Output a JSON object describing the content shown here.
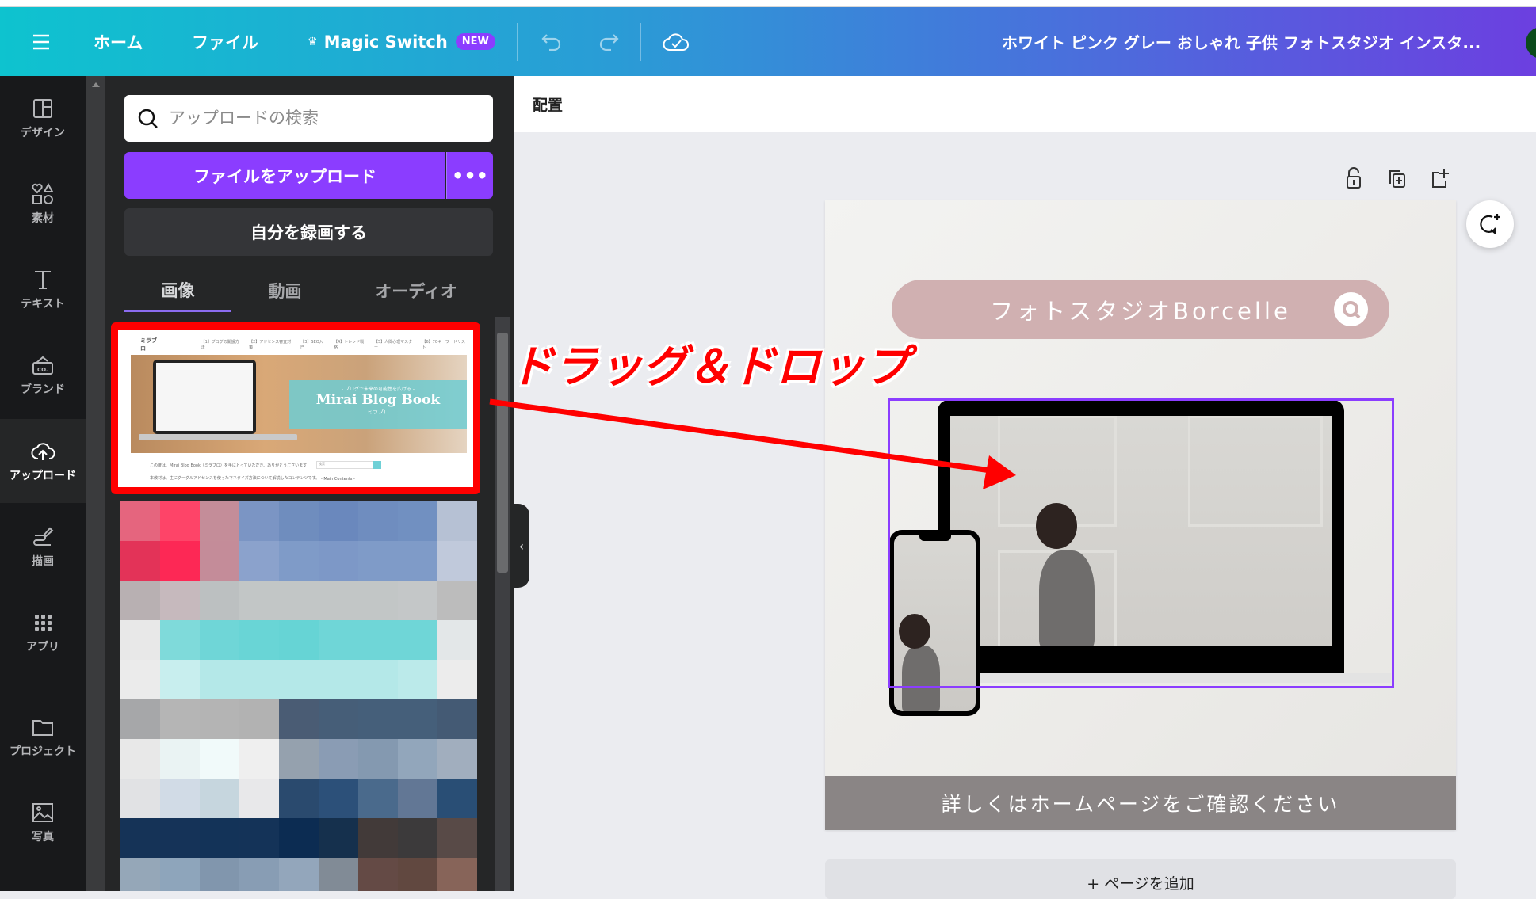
{
  "header": {
    "menu_icon": "hamburger-icon",
    "home": "ホーム",
    "file": "ファイル",
    "magic_switch": "Magic Switch",
    "magic_badge": "NEW",
    "doc_title": "ホワイト ピンク グレー おしゃれ 子供 フォトスタジオ インスタ...",
    "gradient": [
      "#0ec3cf",
      "#6c3fe0"
    ]
  },
  "sidebar": {
    "items": [
      {
        "label": "デザイン",
        "icon": "layout-icon"
      },
      {
        "label": "素材",
        "icon": "shapes-icon"
      },
      {
        "label": "テキスト",
        "icon": "text-icon"
      },
      {
        "label": "ブランド",
        "icon": "brand-icon"
      },
      {
        "label": "アップロード",
        "icon": "cloud-upload-icon",
        "active": true
      },
      {
        "label": "描画",
        "icon": "draw-icon"
      },
      {
        "label": "アプリ",
        "icon": "apps-grid-icon"
      },
      {
        "label": "プロジェクト",
        "icon": "folder-icon"
      },
      {
        "label": "写真",
        "icon": "photo-icon"
      }
    ]
  },
  "panel": {
    "search_placeholder": "アップロードの検索",
    "upload_button": "ファイルをアップロード",
    "more_button": "•••",
    "record_button": "自分を録画する",
    "tabs": [
      {
        "label": "画像",
        "active": true
      },
      {
        "label": "動画"
      },
      {
        "label": "オーディオ"
      }
    ],
    "thumbnail": {
      "site_name": "ミラブロ",
      "nav": [
        "【1】ブログの開設方法",
        "【2】アドセンス審査対策",
        "【3】SEO入門",
        "【4】トレンド戦略",
        "【5】人間心理マスター",
        "【6】70キーワードリスト"
      ],
      "tagline": "- ブログで未来の可能性を広げる -",
      "title": "Mirai Blog Book",
      "subtitle": "ミラブロ",
      "body1": "この度は、Mirai Blog Book（ミラブロ）を手にとっていただき、ありがとうございます！",
      "body2": "本教材は、主にグーグルアドセンスを使ったマネタイズ方法について解説したコンテンツです。",
      "search_label": "検索",
      "side_heading": "- Main Contents -"
    },
    "mosaic_colors": [
      "#e5657e",
      "#fe4468",
      "#c48d99",
      "#7b95c4",
      "#6f8dbe",
      "#6a88bd",
      "#6f8dbf",
      "#7190c1",
      "#b6c1d4",
      "#e33358",
      "#fd2855",
      "#c48c99",
      "#8ba2cc",
      "#7f9bc8",
      "#7d98c7",
      "#7f9bc8",
      "#7f9bc8",
      "#c0c9db",
      "#b8b0b2",
      "#c6b9bd",
      "#bcc0c1",
      "#c2c6c6",
      "#c2c6c6",
      "#c2c6c6",
      "#c2c6c6",
      "#c4c7c8",
      "#bcbcbc",
      "#e8e8e8",
      "#7fdada",
      "#6fd6d7",
      "#69d5d6",
      "#66d4d5",
      "#6fd6d7",
      "#6fd6d7",
      "#6fd6d7",
      "#e3e7e8",
      "#ebebeb",
      "#c8eeee",
      "#b4e8e8",
      "#b4e8e8",
      "#b4e8e8",
      "#b4e8e8",
      "#b4e8e8",
      "#bbeaea",
      "#ececec",
      "#a6a7a9",
      "#b5b5b5",
      "#b4b4b4",
      "#b2b2b2",
      "#4a5c74",
      "#465e78",
      "#455f7a",
      "#455f7a",
      "#445a74",
      "#e8e8e8",
      "#eaf3f3",
      "#f1fafa",
      "#efefef",
      "#95a1ae",
      "#8a9cb4",
      "#8499b0",
      "#92a6bb",
      "#a1aebe",
      "#e1e2e4",
      "#d1dbe6",
      "#c6d6de",
      "#e8e8ea",
      "#2a4a6e",
      "#2c5079",
      "#4a6a8c",
      "#627795",
      "#294e75",
      "#153357",
      "#153358",
      "#133358",
      "#143358",
      "#0c2c52",
      "#15304d",
      "#423a39",
      "#3c3a3b",
      "#584a47",
      "#95a7b8",
      "#8ea5bb",
      "#8196ad",
      "#889db4",
      "#93a6bb",
      "#818b96",
      "#644a45",
      "#614840",
      "#876459"
    ]
  },
  "toolbar": {
    "arrange": "配置"
  },
  "page_tools": [
    {
      "name": "lock",
      "icon": "lock-icon"
    },
    {
      "name": "duplicate",
      "icon": "duplicate-icon"
    },
    {
      "name": "add-page",
      "icon": "add-page-icon"
    }
  ],
  "canvas": {
    "pill_text": "フォトスタジオBorcelle",
    "footer_text": "詳しくはホームページをご確認ください",
    "add_page": "+ ページを追加",
    "pill_color": "#d0b0b1",
    "footer_color": "#8a8585",
    "selection_color": "#8b3dff"
  },
  "annotation": {
    "text": "ドラッグ＆ドロップ",
    "color": "#ff0000"
  }
}
